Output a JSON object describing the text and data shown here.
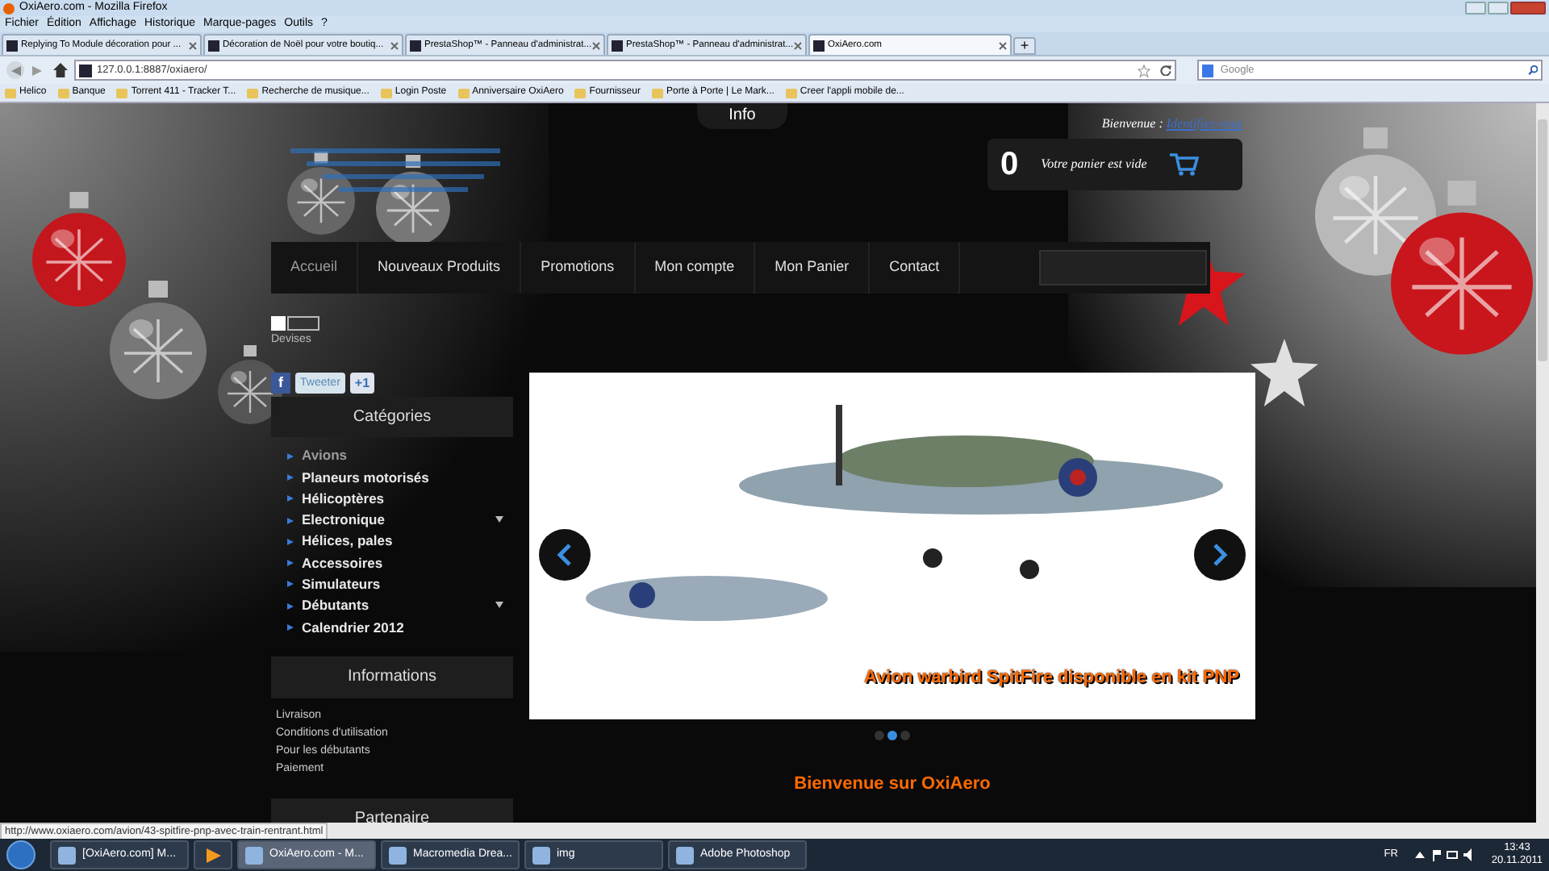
{
  "window": {
    "title": "OxiAero.com - Mozilla Firefox"
  },
  "menu": [
    "Fichier",
    "Édition",
    "Affichage",
    "Historique",
    "Marque-pages",
    "Outils",
    "?"
  ],
  "tabs": [
    {
      "label": "Replying To Module décoration pour ...",
      "selected": false
    },
    {
      "label": "Décoration de Noël pour votre boutiq...",
      "selected": false
    },
    {
      "label": "PrestaShop™ - Panneau d'administrat...",
      "selected": false
    },
    {
      "label": "PrestaShop™ - Panneau d'administrat...",
      "selected": false
    },
    {
      "label": "OxiAero.com",
      "selected": true
    }
  ],
  "new_tab": "+",
  "address": {
    "value": "127.0.0.1:8887/oxiaero/"
  },
  "search": {
    "placeholder": "Google"
  },
  "bookmarks": [
    "Helico",
    "Banque",
    "Torrent 411 - Tracker T...",
    "Recherche de musique...",
    "Login Poste",
    "Anniversaire OxiAero",
    "Fournisseur",
    "Porte à Porte | Le Mark...",
    "Creer l'appli mobile de..."
  ],
  "page": {
    "info_tab": "Info",
    "welcome": {
      "label": "Bienvenue :",
      "link": "Identifiez-vous"
    },
    "cart": {
      "count": "0",
      "label": "Votre panier est vide"
    },
    "nav": [
      {
        "label": "Accueil",
        "selected": true
      },
      {
        "label": "Nouveaux Produits",
        "selected": false
      },
      {
        "label": "Promotions",
        "selected": false
      },
      {
        "label": "Mon compte",
        "selected": false
      },
      {
        "label": "Mon Panier",
        "selected": false
      },
      {
        "label": "Contact",
        "selected": false
      }
    ],
    "currency": {
      "label": "Devises"
    },
    "social": [
      "f",
      "Tweeter",
      "+1"
    ],
    "categories": {
      "title": "Catégories",
      "items": [
        {
          "label": "Avions",
          "selected": true,
          "expandable": false
        },
        {
          "label": "Planeurs motorisés",
          "selected": false,
          "expandable": false
        },
        {
          "label": "Hélicoptères",
          "selected": false,
          "expandable": false
        },
        {
          "label": "Electronique",
          "selected": false,
          "expandable": true
        },
        {
          "label": "Hélices, pales",
          "selected": false,
          "expandable": false
        },
        {
          "label": "Accessoires",
          "selected": false,
          "expandable": false
        },
        {
          "label": "Simulateurs",
          "selected": false,
          "expandable": false
        },
        {
          "label": "Débutants",
          "selected": false,
          "expandable": true
        },
        {
          "label": "Calendrier 2012",
          "selected": false,
          "expandable": false
        }
      ]
    },
    "information": {
      "title": "Informations",
      "links": [
        "Livraison",
        "Conditions d'utilisation",
        "Pour les débutants",
        "Paiement"
      ]
    },
    "partner": {
      "title": "Partenaire"
    },
    "slider": {
      "caption": "Avion warbird SpitFire disponible en kit PNP",
      "dots": [
        {
          "selected": false
        },
        {
          "selected": true
        },
        {
          "selected": false
        }
      ]
    },
    "heading": "Bienvenue sur OxiAero"
  },
  "status_url": "http://www.oxiaero.com/avion/43-spitfire-pnp-avec-train-rentrant.html",
  "taskbar": {
    "items": [
      {
        "kind": "window",
        "label": "[OxiAero.com] M...",
        "selected": false
      },
      {
        "kind": "pinned",
        "selected": false
      },
      {
        "kind": "window",
        "label": "OxiAero.com - M...",
        "selected": true
      },
      {
        "kind": "window",
        "label": "Macromedia Drea...",
        "selected": false
      },
      {
        "kind": "window",
        "label": "img",
        "selected": false
      },
      {
        "kind": "window",
        "label": "Adobe Photoshop",
        "selected": false
      }
    ],
    "language": "FR",
    "time": "13:43",
    "date": "20.11.2011"
  }
}
